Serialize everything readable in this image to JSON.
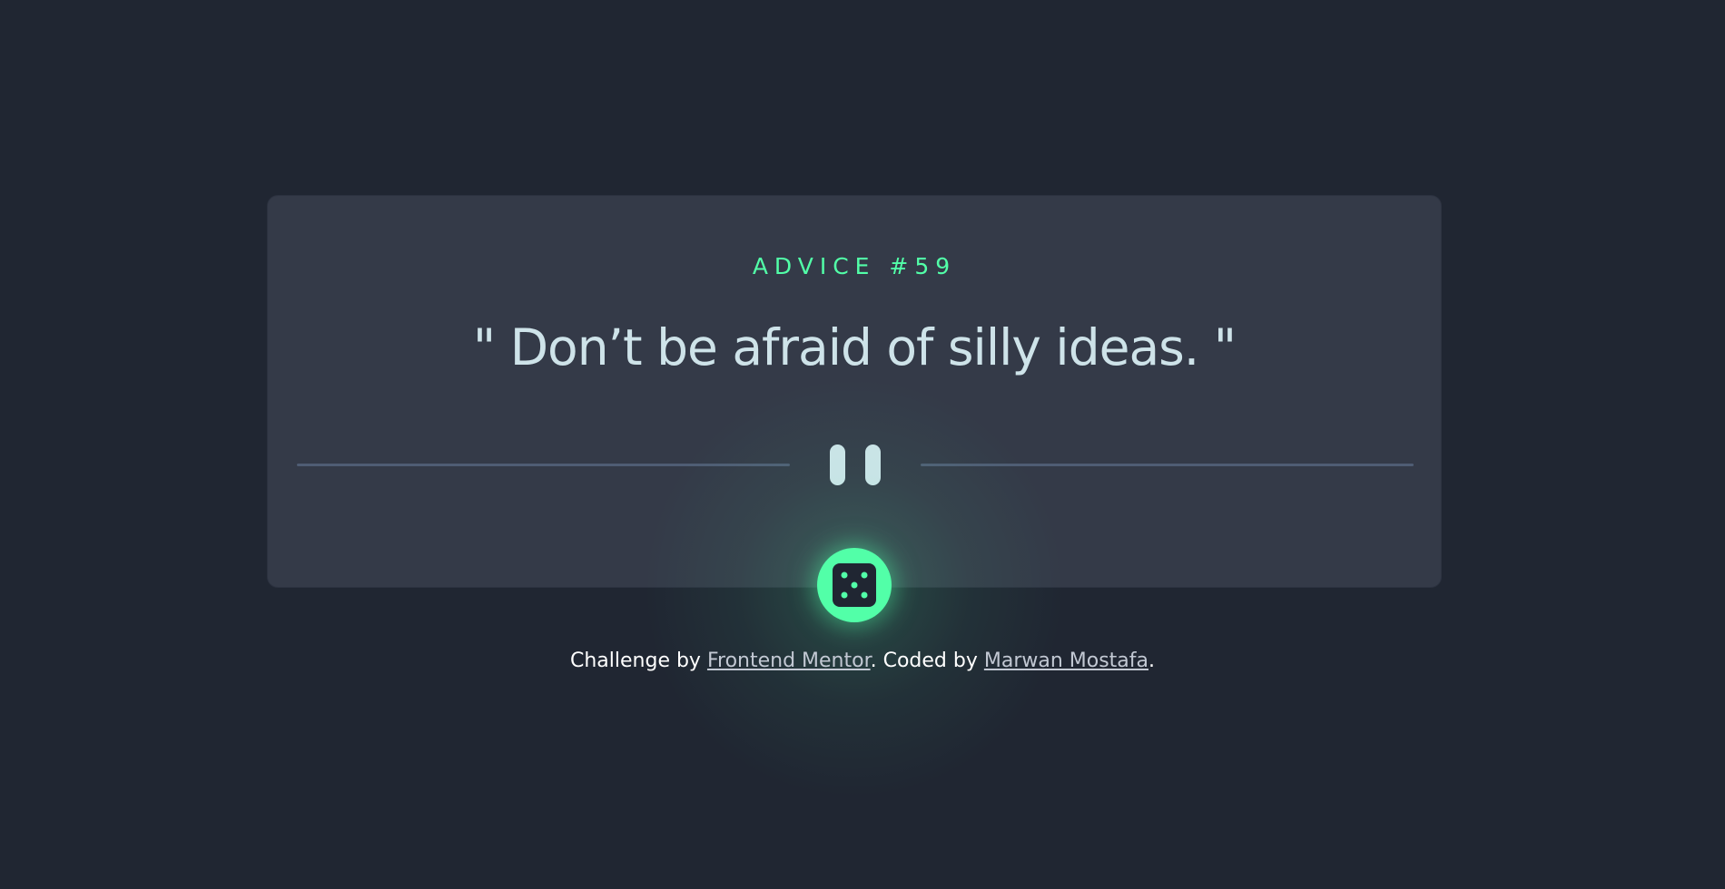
{
  "card": {
    "advice_label": "ADVICE #59",
    "advice_text": "\" Don’t be afraid of silly ideas. \""
  },
  "divider": {
    "icon": "pause-icon"
  },
  "dice_button": {
    "icon": "dice-icon"
  },
  "footer": {
    "prefix": "Challenge by ",
    "link1": "Frontend Mentor",
    "middle": ". Coded by ",
    "link2": "Marwan Mostafa",
    "suffix": "."
  },
  "colors": {
    "background": "#202632",
    "card": "#343a48",
    "accent": "#52ffa8",
    "text": "#cee3e9",
    "divider": "#4f5d74"
  }
}
